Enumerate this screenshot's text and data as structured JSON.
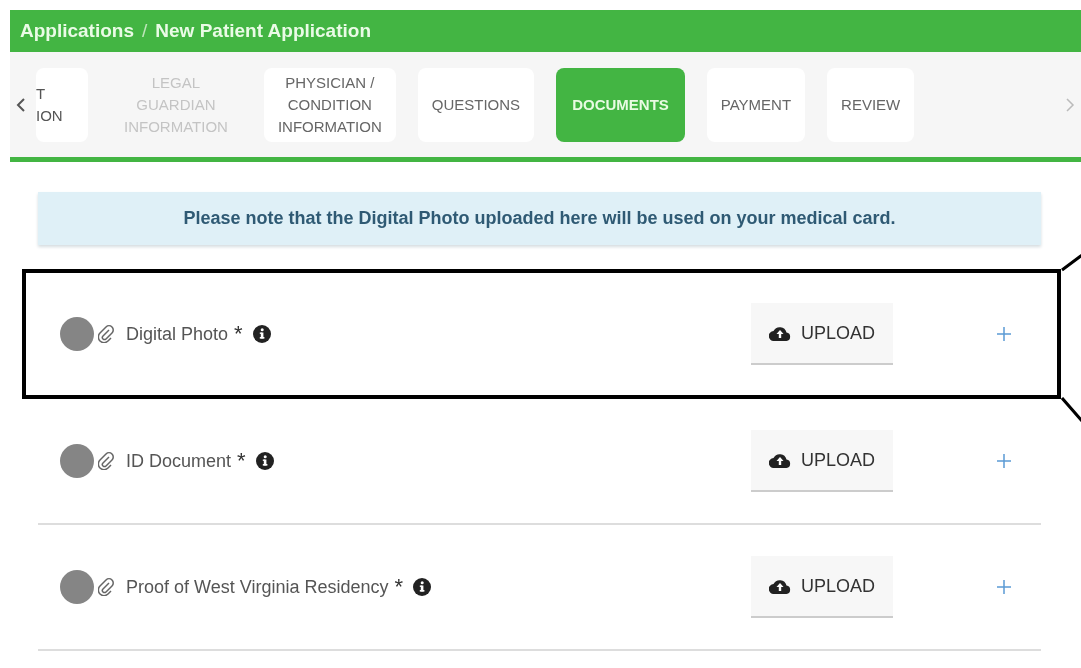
{
  "breadcrumb": {
    "parent": "Applications",
    "separator": "/",
    "current": "New Patient Application"
  },
  "tabs": [
    {
      "lines": [
        "T",
        "ION"
      ],
      "selected": false,
      "disabled": false,
      "kind": "cut"
    },
    {
      "lines": [
        "LEGAL",
        "GUARDIAN",
        "INFORMATION"
      ],
      "selected": false,
      "disabled": true,
      "kind": "full"
    },
    {
      "lines": [
        "PHYSICIAN /",
        "CONDITION",
        "INFORMATION"
      ],
      "selected": false,
      "disabled": false,
      "kind": "full"
    },
    {
      "lines": [
        "QUESTIONS"
      ],
      "selected": false,
      "disabled": false,
      "kind": "full"
    },
    {
      "lines": [
        "DOCUMENTS"
      ],
      "selected": true,
      "disabled": false,
      "kind": "full"
    },
    {
      "lines": [
        "PAYMENT"
      ],
      "selected": false,
      "disabled": false,
      "kind": "full"
    },
    {
      "lines": [
        "REVIEW"
      ],
      "selected": false,
      "disabled": false,
      "kind": "full"
    }
  ],
  "notice": "Please note that the Digital Photo uploaded here will be used on your medical card.",
  "documents": [
    {
      "name": "Digital Photo",
      "required": "*",
      "button": "UPLOAD",
      "highlighted": true
    },
    {
      "name": "ID Document",
      "required": "*",
      "button": "UPLOAD",
      "highlighted": false
    },
    {
      "name": "Proof of West Virginia Residency",
      "required": "*",
      "button": "UPLOAD",
      "highlighted": false
    }
  ]
}
